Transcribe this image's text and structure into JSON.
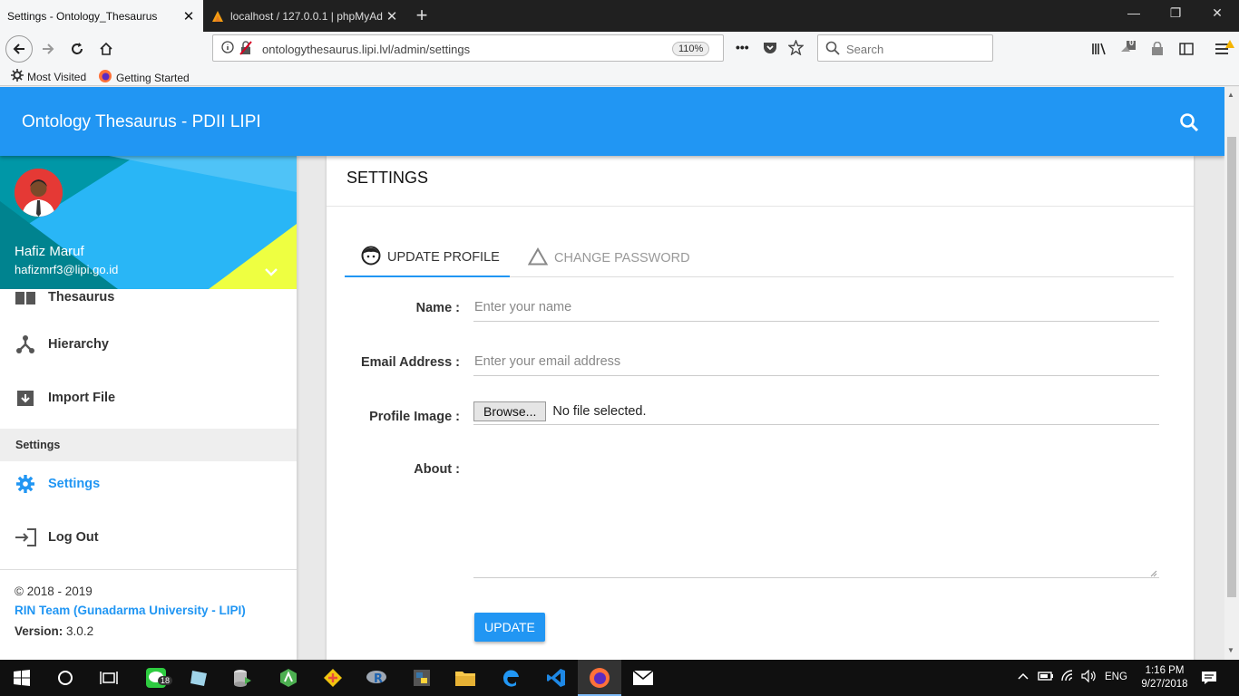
{
  "browser": {
    "tabs": [
      {
        "title": "Settings - Ontology_Thesaurus",
        "active": true
      },
      {
        "title": "localhost / 127.0.0.1 | phpMyAd",
        "active": false
      }
    ],
    "url": "ontologythesaurus.lipi.lvl/admin/settings",
    "zoom": "110%",
    "search_placeholder": "Search",
    "library_badge": "0",
    "bookmarks": [
      "Most Visited",
      "Getting Started"
    ]
  },
  "app": {
    "title": "Ontology Thesaurus - PDII LIPI"
  },
  "user": {
    "name": "Hafiz Maruf",
    "email": "hafizmrf3@lipi.go.id"
  },
  "sidebar": {
    "items": [
      {
        "label": "Thesaurus",
        "icon": "book-icon"
      },
      {
        "label": "Hierarchy",
        "icon": "hierarchy-icon"
      },
      {
        "label": "Import File",
        "icon": "archive-icon"
      }
    ],
    "section_header": "Settings",
    "section_items": [
      {
        "label": "Settings",
        "icon": "gear-icon",
        "active": true
      },
      {
        "label": "Log Out",
        "icon": "logout-icon"
      }
    ],
    "footer": {
      "copyright": "© 2018 - 2019",
      "team": "RIN Team (Gunadarma University - LIPI)",
      "version_label": "Version:",
      "version_value": "3.0.2"
    }
  },
  "settings_card": {
    "title": "SETTINGS",
    "tabs": [
      {
        "label": "UPDATE PROFILE",
        "active": true
      },
      {
        "label": "CHANGE PASSWORD",
        "active": false
      }
    ],
    "form": {
      "name_label": "Name :",
      "name_placeholder": "Enter your name",
      "email_label": "Email Address :",
      "email_placeholder": "Enter your email address",
      "image_label": "Profile Image :",
      "browse_label": "Browse...",
      "no_file": "No file selected.",
      "about_label": "About :",
      "about_value": "",
      "submit_label": "UPDATE"
    }
  },
  "taskbar": {
    "line_badge": "18",
    "language": "ENG",
    "time": "1:16 PM",
    "date": "9/27/2018"
  },
  "colors": {
    "primary": "#2196f3",
    "taskbar": "#101010"
  }
}
